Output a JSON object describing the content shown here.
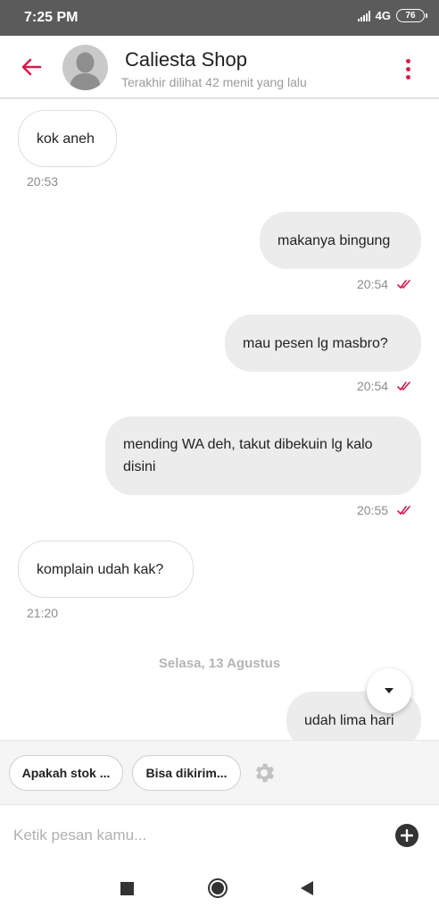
{
  "status_bar": {
    "time": "7:25 PM",
    "network": "4G",
    "battery": "76"
  },
  "header": {
    "title": "Caliesta Shop",
    "subtitle": "Terakhir dilihat 42 menit yang lalu"
  },
  "messages": [
    {
      "text": "kok aneh",
      "time": "20:53",
      "direction": "incoming"
    },
    {
      "text": "makanya bingung",
      "time": "20:54",
      "direction": "outgoing",
      "status": "read"
    },
    {
      "text": "mau pesen lg masbro?",
      "time": "20:54",
      "direction": "outgoing",
      "status": "read"
    },
    {
      "text_line1": "mending WA deh, takut dibekuin lg kalo",
      "text_line2": "disini",
      "time": "20:55",
      "direction": "outgoing",
      "status": "read"
    },
    {
      "text": "komplain udah kak?",
      "time": "21:20",
      "direction": "incoming"
    },
    {
      "text": "udah lima hari",
      "direction": "outgoing"
    }
  ],
  "date_separator": "Selasa, 13 Agustus",
  "quick_replies": [
    "Apakah stok ...",
    "Bisa dikirim..."
  ],
  "composer": {
    "placeholder": "Ketik pesan kamu..."
  },
  "colors": {
    "accent": "#d81b4d",
    "status_bar": "#5b5b5b",
    "outgoing_bubble": "#ececec",
    "read_tick": "#d81b4d"
  },
  "icons": {
    "back": "arrow-left-icon",
    "menu": "more-vertical-icon",
    "avatar": "person-silhouette-icon",
    "read": "double-check-icon",
    "scroll": "caret-down-icon",
    "settings": "gear-icon",
    "add": "plus-circle-icon"
  }
}
